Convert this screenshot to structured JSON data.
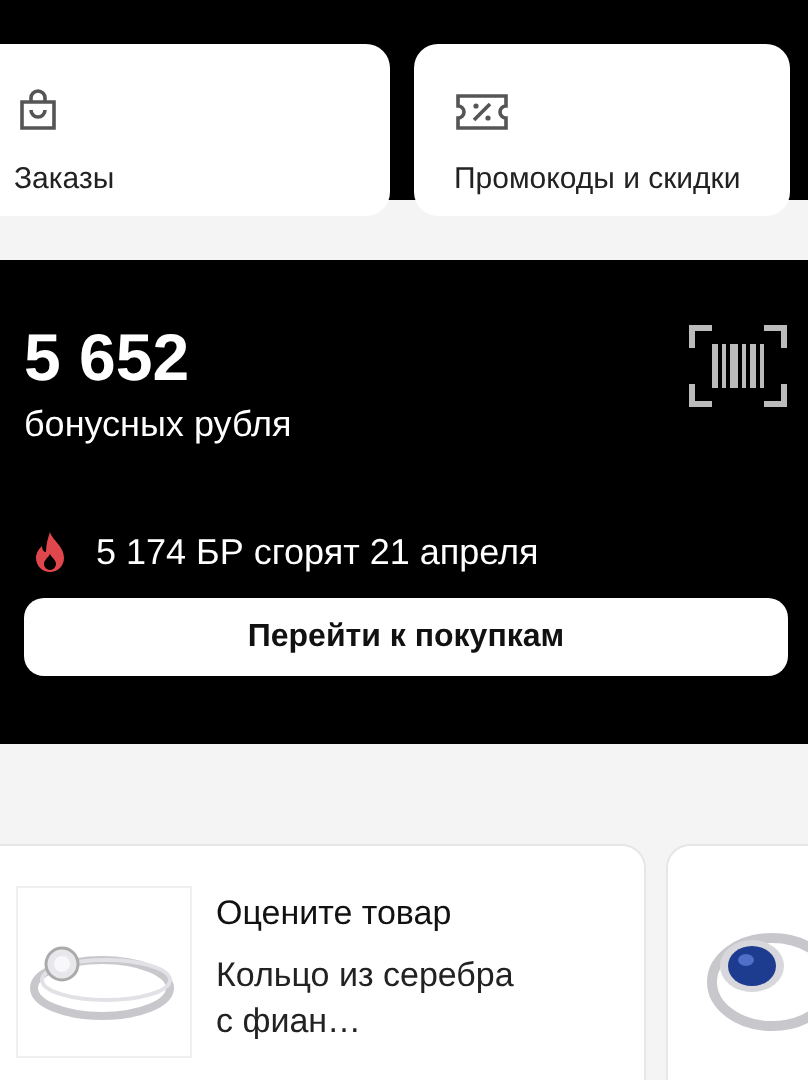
{
  "shortcuts": [
    {
      "kind": "orders",
      "label": "Заказы"
    },
    {
      "kind": "promo",
      "label": "Промокоды и скидки"
    }
  ],
  "bonus": {
    "amount": "5 652",
    "unit": "бонусных рубля",
    "expiry": "5 174 БР сгорят 21 апреля",
    "button": "Перейти к покупкам"
  },
  "review_cards": [
    {
      "kind": "review",
      "title": "Оцените товар",
      "product": "Кольцо из серебра с фиан…"
    },
    {
      "kind": "picture"
    }
  ]
}
